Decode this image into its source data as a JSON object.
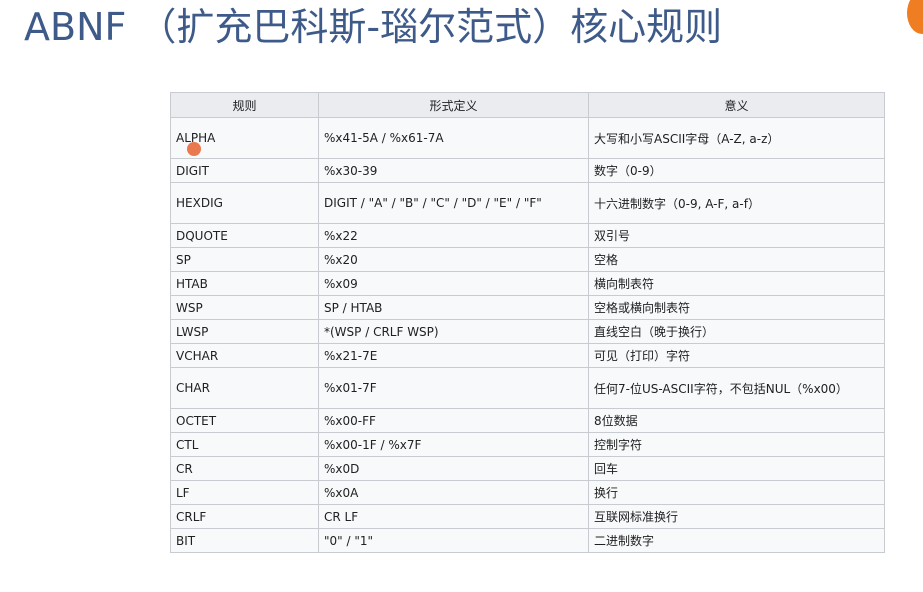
{
  "title": "ABNF （扩充巴科斯-瑙尔范式）核心规则",
  "table": {
    "headers": [
      "规则",
      "形式定义",
      "意义"
    ],
    "rows": [
      {
        "rule": "ALPHA",
        "def": "%x41-5A / %x61-7A",
        "meaning": "大写和小写ASCII字母（A-Z, a-z）",
        "tall": true
      },
      {
        "rule": "DIGIT",
        "def": "%x30-39",
        "meaning": "数字（0-9）",
        "tall": false
      },
      {
        "rule": "HEXDIG",
        "def": "DIGIT / \"A\" / \"B\" / \"C\" / \"D\" / \"E\" / \"F\"",
        "meaning": "十六进制数字（0-9, A-F, a-f）",
        "tall": true
      },
      {
        "rule": "DQUOTE",
        "def": "%x22",
        "meaning": "双引号",
        "tall": false
      },
      {
        "rule": "SP",
        "def": "%x20",
        "meaning": "空格",
        "tall": false
      },
      {
        "rule": "HTAB",
        "def": "%x09",
        "meaning": "横向制表符",
        "tall": false
      },
      {
        "rule": "WSP",
        "def": "SP / HTAB",
        "meaning": "空格或横向制表符",
        "tall": false
      },
      {
        "rule": "LWSP",
        "def": "*(WSP / CRLF WSP)",
        "meaning": "直线空白（晚于换行）",
        "tall": false
      },
      {
        "rule": "VCHAR",
        "def": "%x21-7E",
        "meaning": "可见（打印）字符",
        "tall": false
      },
      {
        "rule": "CHAR",
        "def": "%x01-7F",
        "meaning": "任何7-位US-ASCII字符，不包括NUL（%x00）",
        "tall": true
      },
      {
        "rule": "OCTET",
        "def": "%x00-FF",
        "meaning": "8位数据",
        "tall": false
      },
      {
        "rule": "CTL",
        "def": "%x00-1F / %x7F",
        "meaning": "控制字符",
        "tall": false
      },
      {
        "rule": "CR",
        "def": "%x0D",
        "meaning": "回车",
        "tall": false
      },
      {
        "rule": "LF",
        "def": "%x0A",
        "meaning": "换行",
        "tall": false
      },
      {
        "rule": "CRLF",
        "def": "CR LF",
        "meaning": "互联网标准换行",
        "tall": false
      },
      {
        "rule": "BIT",
        "def": "\"0\" / \"1\"",
        "meaning": "二进制数字",
        "tall": false
      }
    ]
  },
  "colors": {
    "title": "#3d5a89",
    "header_bg": "#eaecf0",
    "cell_bg": "#f8f9fa",
    "border": "#c8ccd1",
    "badge": "#ef7d22",
    "cursor": "#e96a3c"
  }
}
